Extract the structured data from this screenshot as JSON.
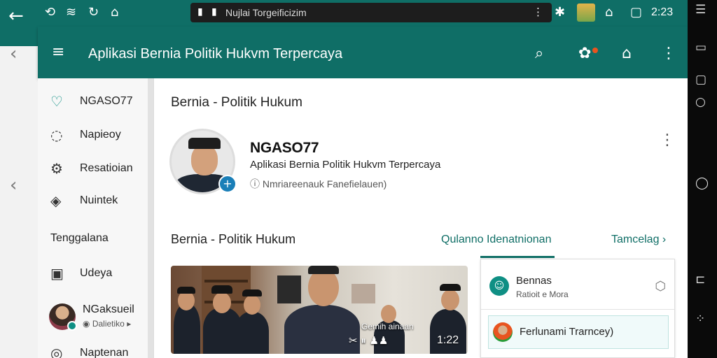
{
  "colors": {
    "header": "#0f6e66",
    "accent": "#0f8f84",
    "link": "#0f6e66"
  },
  "status_bar": {
    "url": "Nujlai Torgeificizim",
    "time": "2:23",
    "icons": [
      "back-arrow-icon",
      "phone-link-icon",
      "wifi-icon",
      "refresh-icon",
      "home-icon",
      "lock-icon",
      "menu-dots-icon",
      "extension-icon",
      "tab-thumbnail-icon",
      "incognito-icon",
      "tab-switcher-icon"
    ]
  },
  "app_header": {
    "title": "Aplikasi Bernia Politik Hukvm Terpercaya",
    "icons": [
      "hamburger-menu-icon",
      "search-icon",
      "notifications-icon",
      "share-icon",
      "overflow-menu-icon"
    ]
  },
  "sidebar": {
    "items": [
      {
        "label": "NGASO77",
        "icon": "heart-icon"
      },
      {
        "label": "Napieoy",
        "icon": "chat-icon"
      },
      {
        "label": "Resatioian",
        "icon": "settings-icon"
      },
      {
        "label": "Nuintek",
        "icon": "layers-icon"
      }
    ],
    "section_title": "Tenggalana",
    "items2": [
      {
        "label": "Udeya",
        "icon": "document-icon"
      }
    ],
    "user": {
      "name": "NGaksueil",
      "subtitle": "Dalietiko"
    },
    "items3": [
      {
        "label": "Naptenan",
        "icon": "ring-icon"
      }
    ]
  },
  "main": {
    "heading": "Bernia - Politik Hukum",
    "profile": {
      "name": "NGASO77",
      "description": "Aplikasi Bernia Politik Hukvm Terpercaya",
      "subtitle": "Nmriareenauk Fanefielauen)"
    },
    "section_title": "Bernia - Politik Hukum",
    "tabs": [
      {
        "label": "Qulanno Idenatnionan",
        "active": true
      },
      {
        "label": "Tamcelag ›",
        "active": false
      }
    ],
    "video": {
      "overlay_text": "Gemih ainaan",
      "controls": "✂ ⏸  ♟♟",
      "time": "1:22"
    },
    "panel": {
      "card1": {
        "title": "Bennas",
        "subtitle": "Ratioit e Mora"
      },
      "card2": {
        "title": "Ferlunami Trarncey)"
      }
    }
  }
}
